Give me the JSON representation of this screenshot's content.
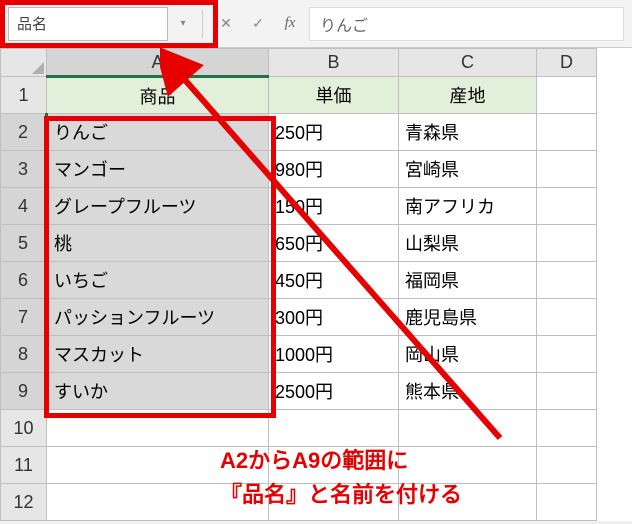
{
  "formula_bar": {
    "name_box_value": "品名",
    "formula_value": "りんご",
    "fx_label": "fx"
  },
  "columns": [
    "A",
    "B",
    "C",
    "D"
  ],
  "row_numbers": [
    "1",
    "2",
    "3",
    "4",
    "5",
    "6",
    "7",
    "8",
    "9",
    "10",
    "11",
    "12"
  ],
  "headers": {
    "A": "商品",
    "B": "単価",
    "C": "産地"
  },
  "rows": [
    {
      "A": "りんご",
      "B": "250円",
      "C": "青森県"
    },
    {
      "A": "マンゴー",
      "B": "980円",
      "C": "宮崎県"
    },
    {
      "A": "グレープフルーツ",
      "B": "150円",
      "C": "南アフリカ"
    },
    {
      "A": "桃",
      "B": "650円",
      "C": "山梨県"
    },
    {
      "A": "いちご",
      "B": "450円",
      "C": "福岡県"
    },
    {
      "A": "パッションフルーツ",
      "B": "300円",
      "C": "鹿児島県"
    },
    {
      "A": "マスカット",
      "B": "1000円",
      "C": "岡山県"
    },
    {
      "A": "すいか",
      "B": "2500円",
      "C": "熊本県"
    }
  ],
  "annotation": {
    "line1": "A2からA9の範囲に",
    "line2": "『品名』と名前を付ける"
  },
  "icons": {
    "cancel": "✕",
    "enter": "✓",
    "dropdown": "▾"
  }
}
